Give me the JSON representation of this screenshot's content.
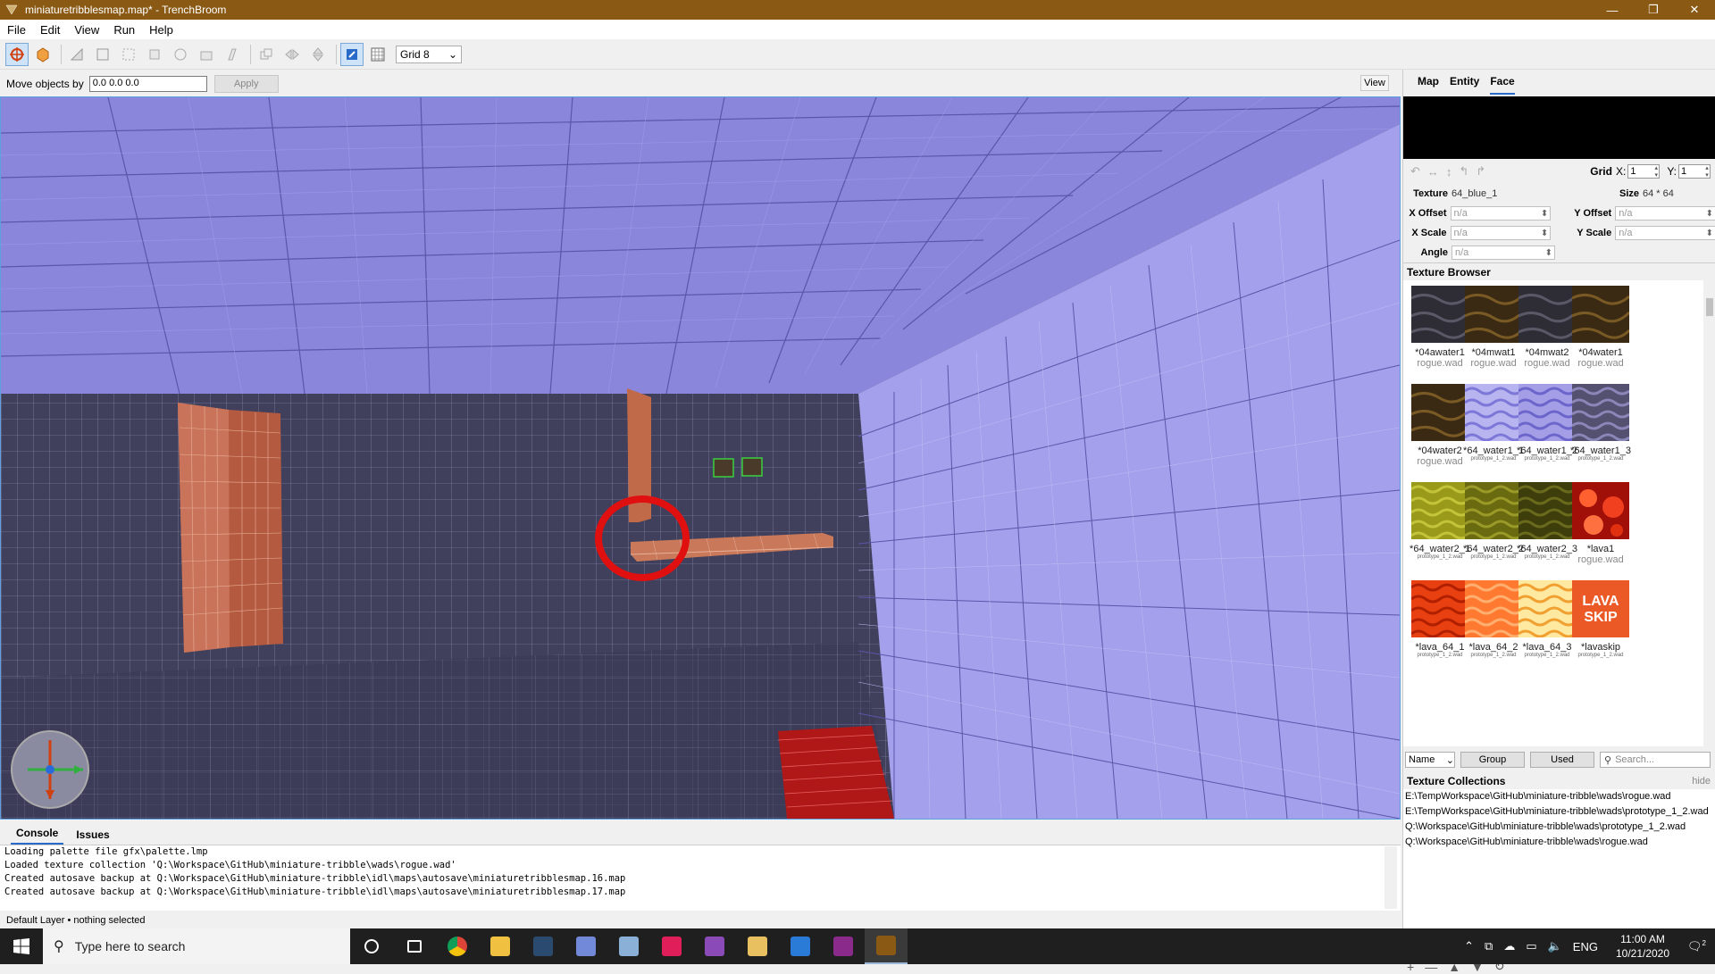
{
  "window": {
    "title": "miniaturetribblesmap.map* - TrenchBroom",
    "controls": [
      "—",
      "❐",
      "✕"
    ]
  },
  "menu": [
    "File",
    "Edit",
    "View",
    "Run",
    "Help"
  ],
  "toolbar": {
    "grid_select": "Grid 8"
  },
  "movebar": {
    "label": "Move objects by",
    "value": "0.0 0.0 0.0",
    "apply_label": "Apply",
    "view_label": "View"
  },
  "console": {
    "tabs": [
      "Console",
      "Issues"
    ],
    "lines": [
      "Loading palette file gfx\\palette.lmp",
      "Loaded texture collection 'Q:\\Workspace\\GitHub\\miniature-tribble\\wads\\rogue.wad'",
      "Created autosave backup at Q:\\Workspace\\GitHub\\miniature-tribble\\idl\\maps\\autosave\\miniaturetribblesmap.16.map",
      "Created autosave backup at Q:\\Workspace\\GitHub\\miniature-tribble\\idl\\maps\\autosave\\miniaturetribblesmap.17.map"
    ],
    "status": "Default Layer • nothing selected"
  },
  "inspector": {
    "tabs": [
      "Map",
      "Entity",
      "Face"
    ],
    "active_tab": "Face",
    "grid": {
      "label": "Grid",
      "x_label": "X:",
      "x_value": "1",
      "y_label": "Y:",
      "y_value": "1"
    },
    "texture_label": "Texture",
    "texture_value": "64_blue_1",
    "size_label": "Size",
    "size_value": "64 * 64",
    "x_offset_label": "X Offset",
    "y_offset_label": "Y Offset",
    "x_scale_label": "X Scale",
    "y_scale_label": "Y Scale",
    "angle_label": "Angle",
    "na": "n/a"
  },
  "texture_browser": {
    "title": "Texture Browser",
    "textures": [
      {
        "name": "*04awater1",
        "wad": "rogue.wad",
        "small": false,
        "kind": "darkwater"
      },
      {
        "name": "*04mwat1",
        "wad": "rogue.wad",
        "small": false,
        "kind": "brownwater"
      },
      {
        "name": "*04mwat2",
        "wad": "rogue.wad",
        "small": false,
        "kind": "darkwater"
      },
      {
        "name": "*04water1",
        "wad": "rogue.wad",
        "small": false,
        "kind": "brownwater"
      },
      {
        "name": "*04water2",
        "wad": "rogue.wad",
        "small": false,
        "kind": "brownwater"
      },
      {
        "name": "*64_water1_1",
        "wad": "prototype_1_2.wad",
        "small": true,
        "kind": "wave",
        "bg": "#b8b4f0",
        "fg": "#7d78d8"
      },
      {
        "name": "*64_water1_2",
        "wad": "prototype_1_2.wad",
        "small": true,
        "kind": "wave",
        "bg": "#a49ee6",
        "fg": "#6c66cc"
      },
      {
        "name": "*64_water1_3",
        "wad": "prototype_1_2.wad",
        "small": true,
        "kind": "wave",
        "bg": "#535070",
        "fg": "#8a86b8"
      },
      {
        "name": "*64_water2_1",
        "wad": "prototype_1_2.wad",
        "small": true,
        "kind": "wave",
        "bg": "#9a9a1a",
        "fg": "#c4c43a"
      },
      {
        "name": "*64_water2_2",
        "wad": "prototype_1_2.wad",
        "small": true,
        "kind": "wave",
        "bg": "#6a6a10",
        "fg": "#9a9a28"
      },
      {
        "name": "*64_water2_3",
        "wad": "prototype_1_2.wad",
        "small": true,
        "kind": "wave",
        "bg": "#3e3e0c",
        "fg": "#6a6a1c"
      },
      {
        "name": "*lava1",
        "wad": "rogue.wad",
        "small": false,
        "kind": "lava"
      },
      {
        "name": "*lava_64_1",
        "wad": "prototype_1_2.wad",
        "small": true,
        "kind": "wave",
        "bg": "#e84010",
        "fg": "#b02000"
      },
      {
        "name": "*lava_64_2",
        "wad": "prototype_1_2.wad",
        "small": true,
        "kind": "wave",
        "bg": "#ff7a30",
        "fg": "#ffb070"
      },
      {
        "name": "*lava_64_3",
        "wad": "prototype_1_2.wad",
        "small": true,
        "kind": "wave",
        "bg": "#ffe8a0",
        "fg": "#f0a030"
      },
      {
        "name": "*lavaskip",
        "wad": "prototype_1_2.wad",
        "small": true,
        "kind": "lavaskip",
        "text1": "LAVA",
        "text2": "SKIP"
      }
    ],
    "sort_select": "Name",
    "group_label": "Group",
    "used_label": "Used",
    "search_placeholder": "Search..."
  },
  "texture_collections": {
    "title": "Texture Collections",
    "hide_label": "hide",
    "items": [
      "E:\\TempWorkspace\\GitHub\\miniature-tribble\\wads\\rogue.wad",
      "E:\\TempWorkspace\\GitHub\\miniature-tribble\\wads\\prototype_1_2.wad",
      "Q:\\Workspace\\GitHub\\miniature-tribble\\wads\\prototype_1_2.wad",
      "Q:\\Workspace\\GitHub\\miniature-tribble\\wads\\rogue.wad"
    ],
    "buttons": [
      "+",
      "—",
      "▲",
      "▼",
      "↻"
    ]
  },
  "taskbar": {
    "search_placeholder": "Type here to search",
    "apps": [
      {
        "name": "cortana-icon",
        "color": "#1f1f1f"
      },
      {
        "name": "task-view-icon",
        "color": "#1f1f1f"
      },
      {
        "name": "chrome-icon",
        "color": "#e0a020"
      },
      {
        "name": "file-explorer-icon",
        "color": "#f0c040"
      },
      {
        "name": "steam-icon",
        "color": "#2a4a70"
      },
      {
        "name": "discord-icon",
        "color": "#7289da"
      },
      {
        "name": "notepad-icon",
        "color": "#8ab0d8"
      },
      {
        "name": "slack-icon",
        "color": "#e01e5a"
      },
      {
        "name": "app-purple-icon",
        "color": "#8a4ab8"
      },
      {
        "name": "app-fish-icon",
        "color": "#e8c060"
      },
      {
        "name": "mail-icon",
        "color": "#2a7ad8"
      },
      {
        "name": "winrar-icon",
        "color": "#8a2a8a"
      },
      {
        "name": "trenchbroom-icon",
        "color": "#8a5a14"
      }
    ],
    "tray_lang": "ENG",
    "time": "11:00 AM",
    "date": "10/21/2020",
    "notification_count": "2",
    "mail_badge": "2"
  }
}
